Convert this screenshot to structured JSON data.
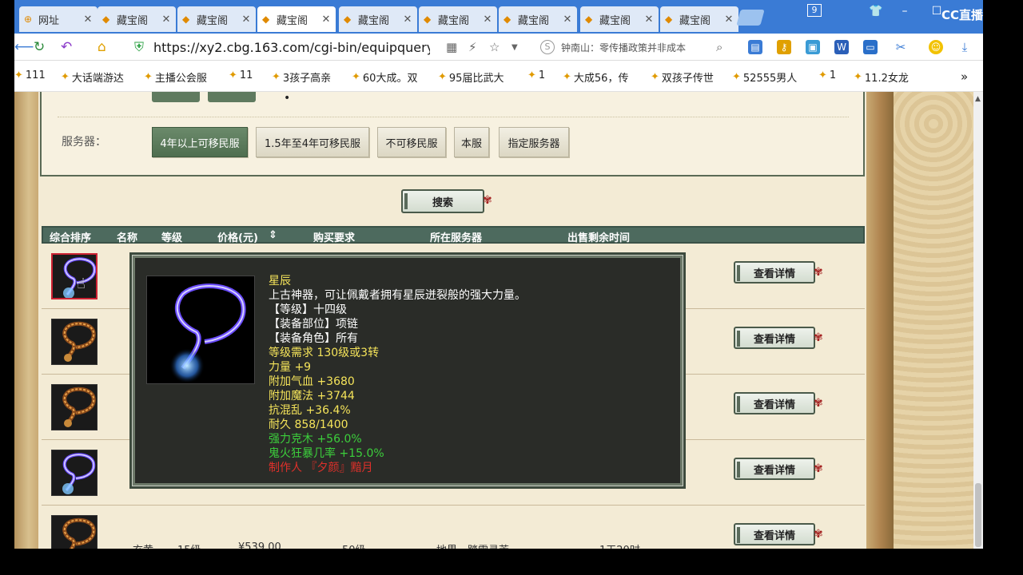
{
  "tabs": [
    {
      "label": "网址",
      "icon": "globe-icon"
    },
    {
      "label": "藏宝阁",
      "icon": "cbg-icon"
    },
    {
      "label": "藏宝阁",
      "icon": "cbg-icon"
    },
    {
      "label": "藏宝阁",
      "icon": "cbg-icon",
      "active": true
    },
    {
      "label": "藏宝阁",
      "icon": "cbg-icon"
    },
    {
      "label": "藏宝阁",
      "icon": "cbg-icon"
    },
    {
      "label": "藏宝阁",
      "icon": "cbg-icon"
    },
    {
      "label": "藏宝阁",
      "icon": "cbg-icon"
    },
    {
      "label": "藏宝阁",
      "icon": "cbg-icon"
    }
  ],
  "window": {
    "tab_count_badge": "9",
    "brand": "CC直播"
  },
  "address": {
    "url": "https://xy2.cbg.163.com/cgi-bin/equipquery.p",
    "search_hint": "钟南山：零传播政策并非成本"
  },
  "bookmarks": [
    "111",
    "大话端游达",
    "主播公会服",
    "11",
    "3孩子高亲",
    "60大成。双",
    "95届比武大",
    "1",
    "大成56，传",
    "双孩子传世",
    "52555男人",
    "1",
    "11.2女龙"
  ],
  "filter": {
    "server_label": "服务器：",
    "server_options": [
      {
        "label": "4年以上可移民服",
        "selected": true
      },
      {
        "label": "1.5年至4年可移民服",
        "selected": false
      },
      {
        "label": "不可移民服",
        "selected": false
      },
      {
        "label": "本服",
        "selected": false
      },
      {
        "label": "指定服务器",
        "selected": false
      }
    ],
    "dot": "•",
    "search_button": "搜索"
  },
  "list": {
    "headers": [
      "综合排序",
      "名称",
      "等级",
      "价格(元)",
      "购买要求",
      "所在服务器",
      "出售剩余时间"
    ],
    "sort_icon": "sort-updown-icon",
    "detail_label": "查看详情",
    "rows": [
      {
        "item": "blue-necklace",
        "highlight": true,
        "name": "",
        "level": "",
        "price": "",
        "req": "",
        "server": "",
        "time": ""
      },
      {
        "item": "brown-necklace",
        "highlight": false,
        "name": "",
        "level": "",
        "price": "",
        "req": "",
        "server": "",
        "time": ""
      },
      {
        "item": "brown-necklace",
        "highlight": false,
        "name": "",
        "level": "",
        "price": "",
        "req": "",
        "server": "",
        "time": ""
      },
      {
        "item": "blue-necklace",
        "highlight": false,
        "name": "",
        "level": "",
        "price": "",
        "req": "",
        "server": "",
        "time": ""
      },
      {
        "item": "brown-necklace",
        "highlight": false,
        "name": "玄黄",
        "level": "15级",
        "price": "¥539.00",
        "req": "50级",
        "server": "地界一踏雪寻芳",
        "time": "1天20时"
      }
    ]
  },
  "tooltip": {
    "lines": [
      {
        "text": "星辰",
        "color": "#f5e45a"
      },
      {
        "text": "上古神器，可让佩戴者拥有星辰迸裂般的强大力量。",
        "color": "#ffffff"
      },
      {
        "text": "【等级】十四级",
        "color": "#ffffff"
      },
      {
        "text": "【装备部位】项链",
        "color": "#ffffff"
      },
      {
        "text": "【装备角色】所有",
        "color": "#ffffff"
      },
      {
        "text": "等级需求 130级或3转",
        "color": "#f5e45a"
      },
      {
        "text": "力量 +9",
        "color": "#f5e45a"
      },
      {
        "text": "附加气血 +3680",
        "color": "#f5e45a"
      },
      {
        "text": "附加魔法 +3744",
        "color": "#f5e45a"
      },
      {
        "text": "抗混乱 +36.4%",
        "color": "#f5e45a"
      },
      {
        "text": "耐久 858/1400",
        "color": "#f5e45a"
      },
      {
        "text": "强力克木 +56.0%",
        "color": "#3ccf3c"
      },
      {
        "text": "鬼火狂暴几率 +15.0%",
        "color": "#3ccf3c"
      },
      {
        "text": "制作人 『夕颜』黯月",
        "color": "#e0302a"
      }
    ]
  }
}
